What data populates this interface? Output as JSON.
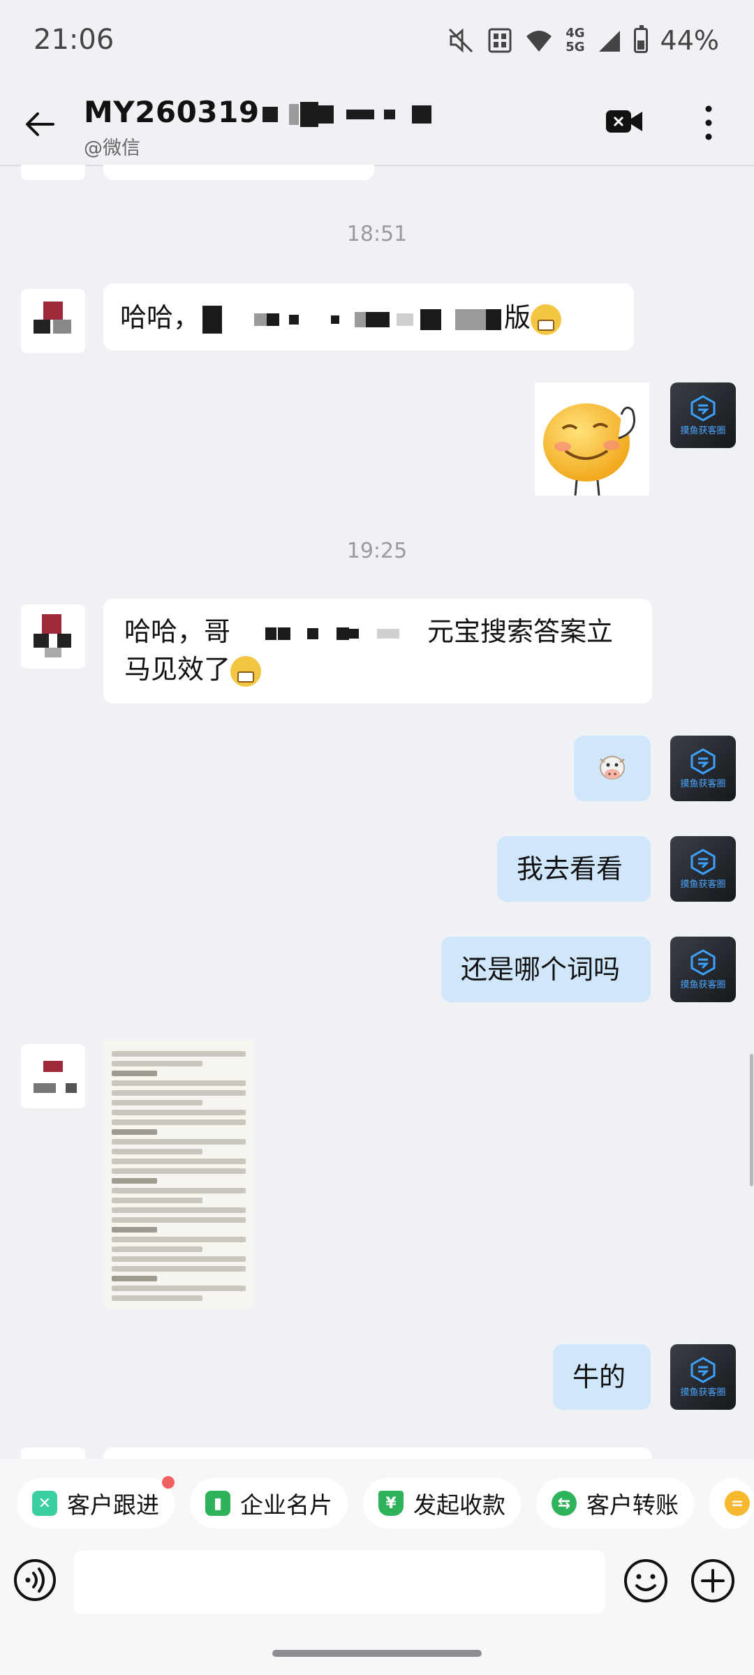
{
  "status_bar": {
    "time": "21:06",
    "network_top": "4G",
    "network_bottom": "5G",
    "battery": "44%",
    "battery_level": 0.44
  },
  "header": {
    "title": "MY260319",
    "subtitle": "@微信"
  },
  "timestamps": [
    "18:51",
    "19:25"
  ],
  "messages": {
    "m1": {
      "prefix": "哈哈，",
      "suffix": "版"
    },
    "m3_line1": {
      "prefix": "哈哈，哥",
      "suffix": "元宝搜索答案立"
    },
    "m3_line2": "马见效了",
    "m5": "我去看看",
    "m6": "还是哪个词吗",
    "m8": "牛的"
  },
  "avatar_text": "摸鱼获客圈",
  "quick_actions": [
    "客户跟进",
    "企业名片",
    "发起收款",
    "客户转账"
  ],
  "colors": {
    "outgoing_bubble": "#cfe6fb",
    "incoming_bubble": "#ffffff",
    "background": "#f0f1f5",
    "notification_dot": "#f26161"
  }
}
